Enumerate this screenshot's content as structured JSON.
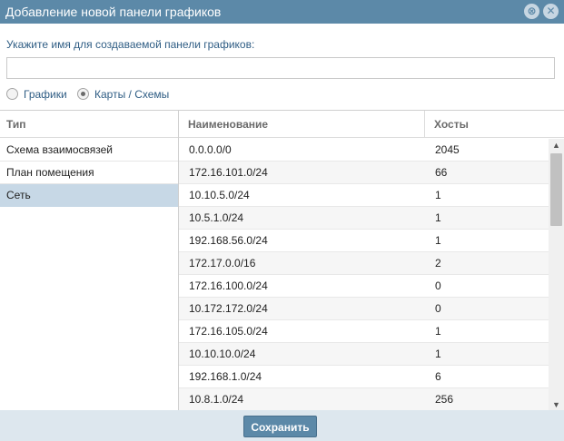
{
  "dialog": {
    "title": "Добавление новой панели графиков",
    "minimize_icon": "collapse-icon",
    "close_icon": "close-icon"
  },
  "form": {
    "name_label": "Укажите имя для создаваемой панели графиков:",
    "name_value": "",
    "options": [
      {
        "label": "Графики",
        "checked": false
      },
      {
        "label": "Карты / Схемы",
        "checked": true
      }
    ]
  },
  "type_panel": {
    "header": "Тип",
    "items": [
      {
        "label": "Схема взаимосвязей",
        "selected": false
      },
      {
        "label": "План помещения",
        "selected": false
      },
      {
        "label": "Сеть",
        "selected": true
      }
    ]
  },
  "network_table": {
    "headers": {
      "name": "Наименование",
      "hosts": "Хосты"
    },
    "rows": [
      {
        "name": "0.0.0.0/0",
        "hosts": "2045"
      },
      {
        "name": "172.16.101.0/24",
        "hosts": "66"
      },
      {
        "name": "10.10.5.0/24",
        "hosts": "1"
      },
      {
        "name": "10.5.1.0/24",
        "hosts": "1"
      },
      {
        "name": "192.168.56.0/24",
        "hosts": "1"
      },
      {
        "name": "172.17.0.0/16",
        "hosts": "2"
      },
      {
        "name": "172.16.100.0/24",
        "hosts": "0"
      },
      {
        "name": "10.172.172.0/24",
        "hosts": "0"
      },
      {
        "name": "172.16.105.0/24",
        "hosts": "1"
      },
      {
        "name": "10.10.10.0/24",
        "hosts": "1"
      },
      {
        "name": "192.168.1.0/24",
        "hosts": "6"
      },
      {
        "name": "10.8.1.0/24",
        "hosts": "256"
      }
    ]
  },
  "footer": {
    "save_label": "Сохранить"
  },
  "colors": {
    "accent": "#5c89a8",
    "selection": "#c7d8e6",
    "footer_bg": "#dde7ee"
  }
}
